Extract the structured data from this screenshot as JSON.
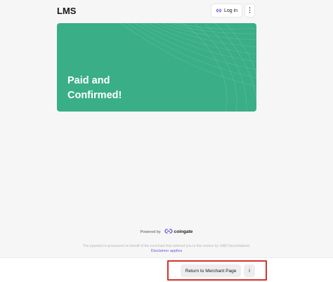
{
  "header": {
    "merchant_name": "LMS",
    "login_label": "Log in",
    "login_icon": "coingate-link-icon",
    "more_icon": "kebab-menu-icon"
  },
  "status_card": {
    "title_line1": "Paid and",
    "title_line2": "Confirmed!",
    "background_color": "#3aae87"
  },
  "footer": {
    "powered_by": "Powered by",
    "brand": "coingate",
    "legal_text": "The payment is processed on behalf of the merchant that referred you to this invoice by UAB Decentralized.",
    "disclaimer_link": "Disclaimer applies"
  },
  "actions": {
    "return_label": "Return to Merchant Page",
    "info_label": "i"
  },
  "colors": {
    "accent_green": "#3aae87",
    "link_purple": "#6f5bd8",
    "highlight_red": "#d6332a"
  }
}
